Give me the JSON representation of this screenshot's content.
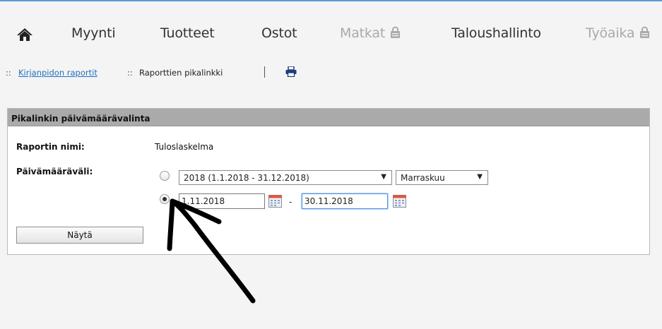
{
  "nav": {
    "items": [
      {
        "label": "Myynti",
        "disabled": false
      },
      {
        "label": "Tuotteet",
        "disabled": false
      },
      {
        "label": "Ostot",
        "disabled": false
      },
      {
        "label": "Matkat",
        "disabled": true
      },
      {
        "label": "Taloushallinto",
        "disabled": false
      },
      {
        "label": "Työaika",
        "disabled": true
      }
    ]
  },
  "breadcrumb": {
    "sep": "::",
    "link": "Kirjanpidon raportit",
    "current": "Raporttien pikalinkki"
  },
  "panel": {
    "title": "Pikalinkin päivämäärävalinta",
    "report_label": "Raportin nimi:",
    "report_value": "Tuloslaskelma",
    "range_label": "Päivämääräväli:",
    "period_select": "2018 (1.1.2018 - 31.12.2018)",
    "month_select": "Marraskuu",
    "start_date": "1.11.2018",
    "end_date": "30.11.2018",
    "range_dash": "-",
    "show_button": "Näytä"
  },
  "colors": {
    "accent_line": "#5b9bd5",
    "link": "#1e6fc0",
    "panel_header": "#aaaaaa"
  }
}
